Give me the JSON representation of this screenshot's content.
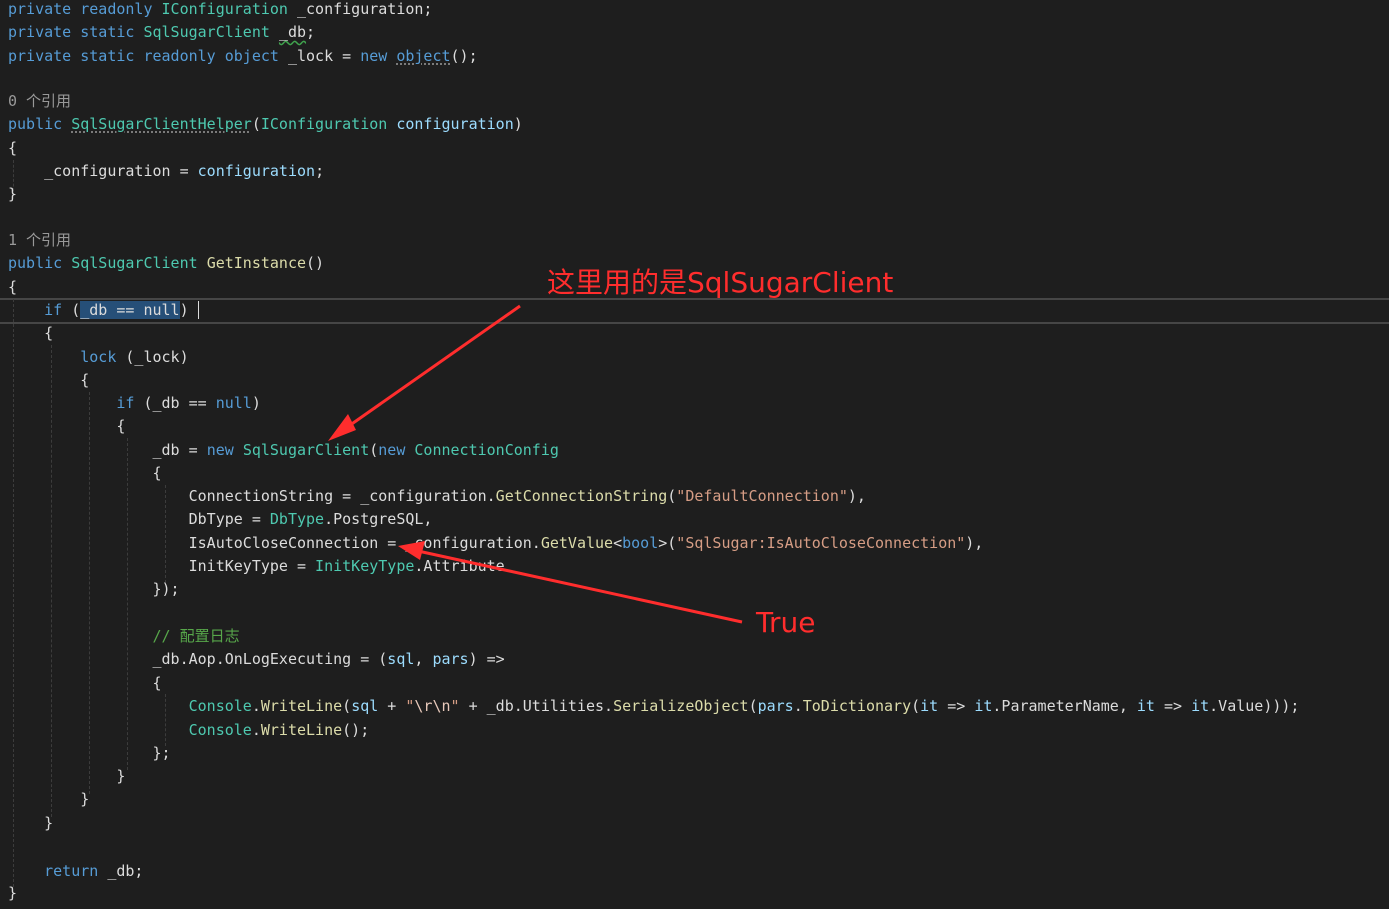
{
  "code": {
    "l1": {
      "a": "private readonly ",
      "b": "IConfiguration",
      "c": " _configuration;"
    },
    "l2": {
      "a": "private static ",
      "b": "SqlSugarClient",
      "c": " ",
      "d": "_db",
      "e": ";"
    },
    "l3": {
      "a": "private static readonly object ",
      "b": "_lock",
      "c": " = ",
      "d": "new",
      "e": " ",
      "f": "object",
      "g": "();"
    },
    "ref0": "0 个引用",
    "l5": {
      "a": "public ",
      "b": "SqlSugarClientHelper",
      "c": "(",
      "d": "IConfiguration",
      "e": " ",
      "f": "configuration",
      "g": ")"
    },
    "l6": "{",
    "l7": {
      "a": "    _configuration = ",
      "b": "configuration",
      "c": ";"
    },
    "l8": "}",
    "ref1": "1 个引用",
    "l10": {
      "a": "public ",
      "b": "SqlSugarClient",
      "c": " ",
      "d": "GetInstance",
      "e": "()"
    },
    "l11": "{",
    "l12": {
      "a": "    ",
      "b": "if",
      "c": " (",
      "d": "_db == null",
      "e": ")"
    },
    "l13": "    {",
    "l14": {
      "a": "        ",
      "b": "lock",
      "c": " (_lock)"
    },
    "l15": "        {",
    "l16": {
      "a": "            ",
      "b": "if",
      "c": " (_db == ",
      "d": "null",
      "e": ")"
    },
    "l17": "            {",
    "l18": {
      "a": "                _db = ",
      "b": "new",
      "c": " ",
      "d": "SqlSugarClient",
      "e": "(",
      "f": "new",
      "g": " ",
      "h": "ConnectionConfig"
    },
    "l19": "                {",
    "l20": {
      "a": "                    ConnectionString = _configuration.",
      "b": "GetConnectionString",
      "c": "(",
      "d": "\"DefaultConnection\"",
      "e": "),"
    },
    "l21": {
      "a": "                    DbType = ",
      "b": "DbType",
      "c": ".PostgreSQL,"
    },
    "l22": {
      "a": "                    IsAutoCloseConnection = _configuration.",
      "b": "GetValue",
      "c": "<",
      "d": "bool",
      "e": ">(",
      "f": "\"SqlSugar:IsAutoCloseConnection\"",
      "g": "),"
    },
    "l23": {
      "a": "                    InitKeyType = ",
      "b": "InitKeyType",
      "c": ".Attribute"
    },
    "l24": "                });",
    "l26": "                // 配置日志",
    "l27": {
      "a": "                _db.Aop.OnLogExecuting = (",
      "b": "sql",
      "c": ", ",
      "d": "pars",
      "e": ") =>"
    },
    "l28": "                {",
    "l29": {
      "a": "                    ",
      "b": "Console",
      "c": ".",
      "d": "WriteLine",
      "e": "(",
      "f": "sql",
      "g": " + ",
      "h": "\"",
      "i": "\\r\\n",
      "j": "\"",
      "k": " + _db.Utilities.",
      "l": "SerializeObject",
      "m": "(",
      "n": "pars",
      "o": ".",
      "p": "ToDictionary",
      "q": "(",
      "r": "it",
      "s": " => ",
      "t": "it",
      "u": ".ParameterName, ",
      "v": "it",
      "w": " => ",
      "x": "it",
      "y": ".Value)));"
    },
    "l30": {
      "a": "                    ",
      "b": "Console",
      "c": ".",
      "d": "WriteLine",
      "e": "();"
    },
    "l31": "                };",
    "l32": "            }",
    "l33": "        }",
    "l34": "    }",
    "l36": {
      "a": "    ",
      "b": "return",
      "c": " _db;"
    },
    "l37": "}"
  },
  "annotations": {
    "top": "这里用的是SqlSugarClient",
    "bottom": "True"
  },
  "colors": {
    "background": "#1e1e1e",
    "keyword": "#569cd6",
    "type": "#4ec9b0",
    "method": "#dcdcaa",
    "parameter": "#9cdcfe",
    "string": "#d69d85",
    "comment": "#57a64a",
    "annotation": "#ff2d2d"
  }
}
